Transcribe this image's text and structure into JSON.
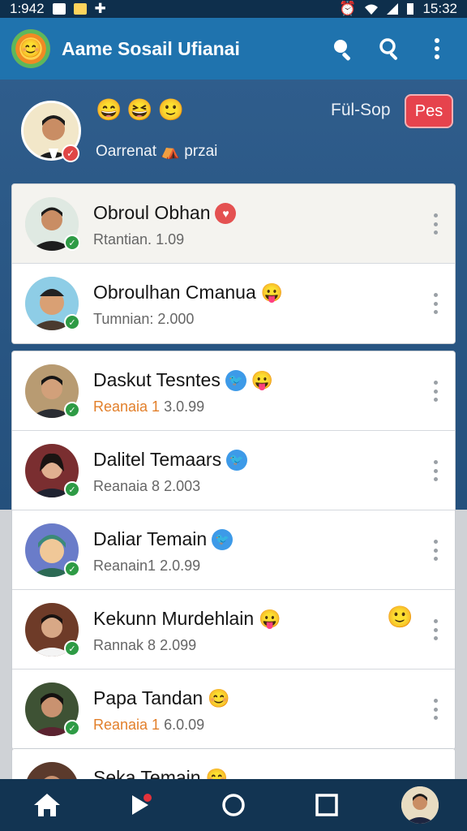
{
  "status_bar": {
    "time_left": "1:942",
    "time_right": "15:32"
  },
  "app": {
    "title": "Aame Sosail Ufianai"
  },
  "profile": {
    "emojis": [
      "😄",
      "😆",
      "🙂"
    ],
    "status": "Oarrenat ⛺ przai",
    "follow_label": "Fül-Sop",
    "button_label": "Pes"
  },
  "list": [
    {
      "name": "Obroul Obhan",
      "badge": "heart",
      "prefix": "Rtantian.",
      "prefix_orange": false,
      "value": "1.09",
      "tint": "#dfe9e2"
    },
    {
      "name": "Obroulhan Cmanua",
      "badge": "emoji",
      "badge_emoji": "😛",
      "prefix": "Tumnian:",
      "prefix_orange": false,
      "value": "2.000",
      "tint": "#8ecde6"
    },
    {
      "name": "Daskut Tesntes",
      "badge": "twitter+emoji",
      "badge_emoji": "😛",
      "prefix": "Reanaia 1",
      "prefix_orange": true,
      "value": "3.0.99",
      "tint": "#b89b72"
    },
    {
      "name": "Dalitel Temaars",
      "badge": "twitter",
      "prefix": "Reanaia 8",
      "prefix_orange": false,
      "value": "2.003",
      "tint": "#7a2e30"
    },
    {
      "name": "Daliar Temain",
      "badge": "twitter",
      "prefix": "Reanain1",
      "prefix_orange": false,
      "value": "2.0.99",
      "tint": "#6a7cc9"
    },
    {
      "name": "Kekunn Murdehlain",
      "badge": "emoji",
      "badge_emoji": "😛",
      "extra_emoji": "🙂",
      "prefix": "Rannak 8",
      "prefix_orange": false,
      "value": "2.099",
      "tint": "#6e3b28"
    },
    {
      "name": "Papa Tandan",
      "badge": "emoji",
      "badge_emoji": "😊",
      "prefix": "Reanaia 1",
      "prefix_orange": true,
      "value": "6.0.09",
      "tint": "#3e5234"
    },
    {
      "name": "Seka Temain",
      "badge": "emoji",
      "badge_emoji": "😊",
      "prefix": "",
      "prefix_orange": false,
      "value": "",
      "tint": "#5b3a2c"
    }
  ],
  "icons": {
    "search": "search-icon",
    "menu": "more-vert-icon",
    "home": "home-icon",
    "play": "play-icon",
    "circle": "circle-icon",
    "square": "square-icon"
  },
  "colors": {
    "appbar": "#1f73ae",
    "accent_red": "#e6434d",
    "verified": "#2e9b45"
  }
}
